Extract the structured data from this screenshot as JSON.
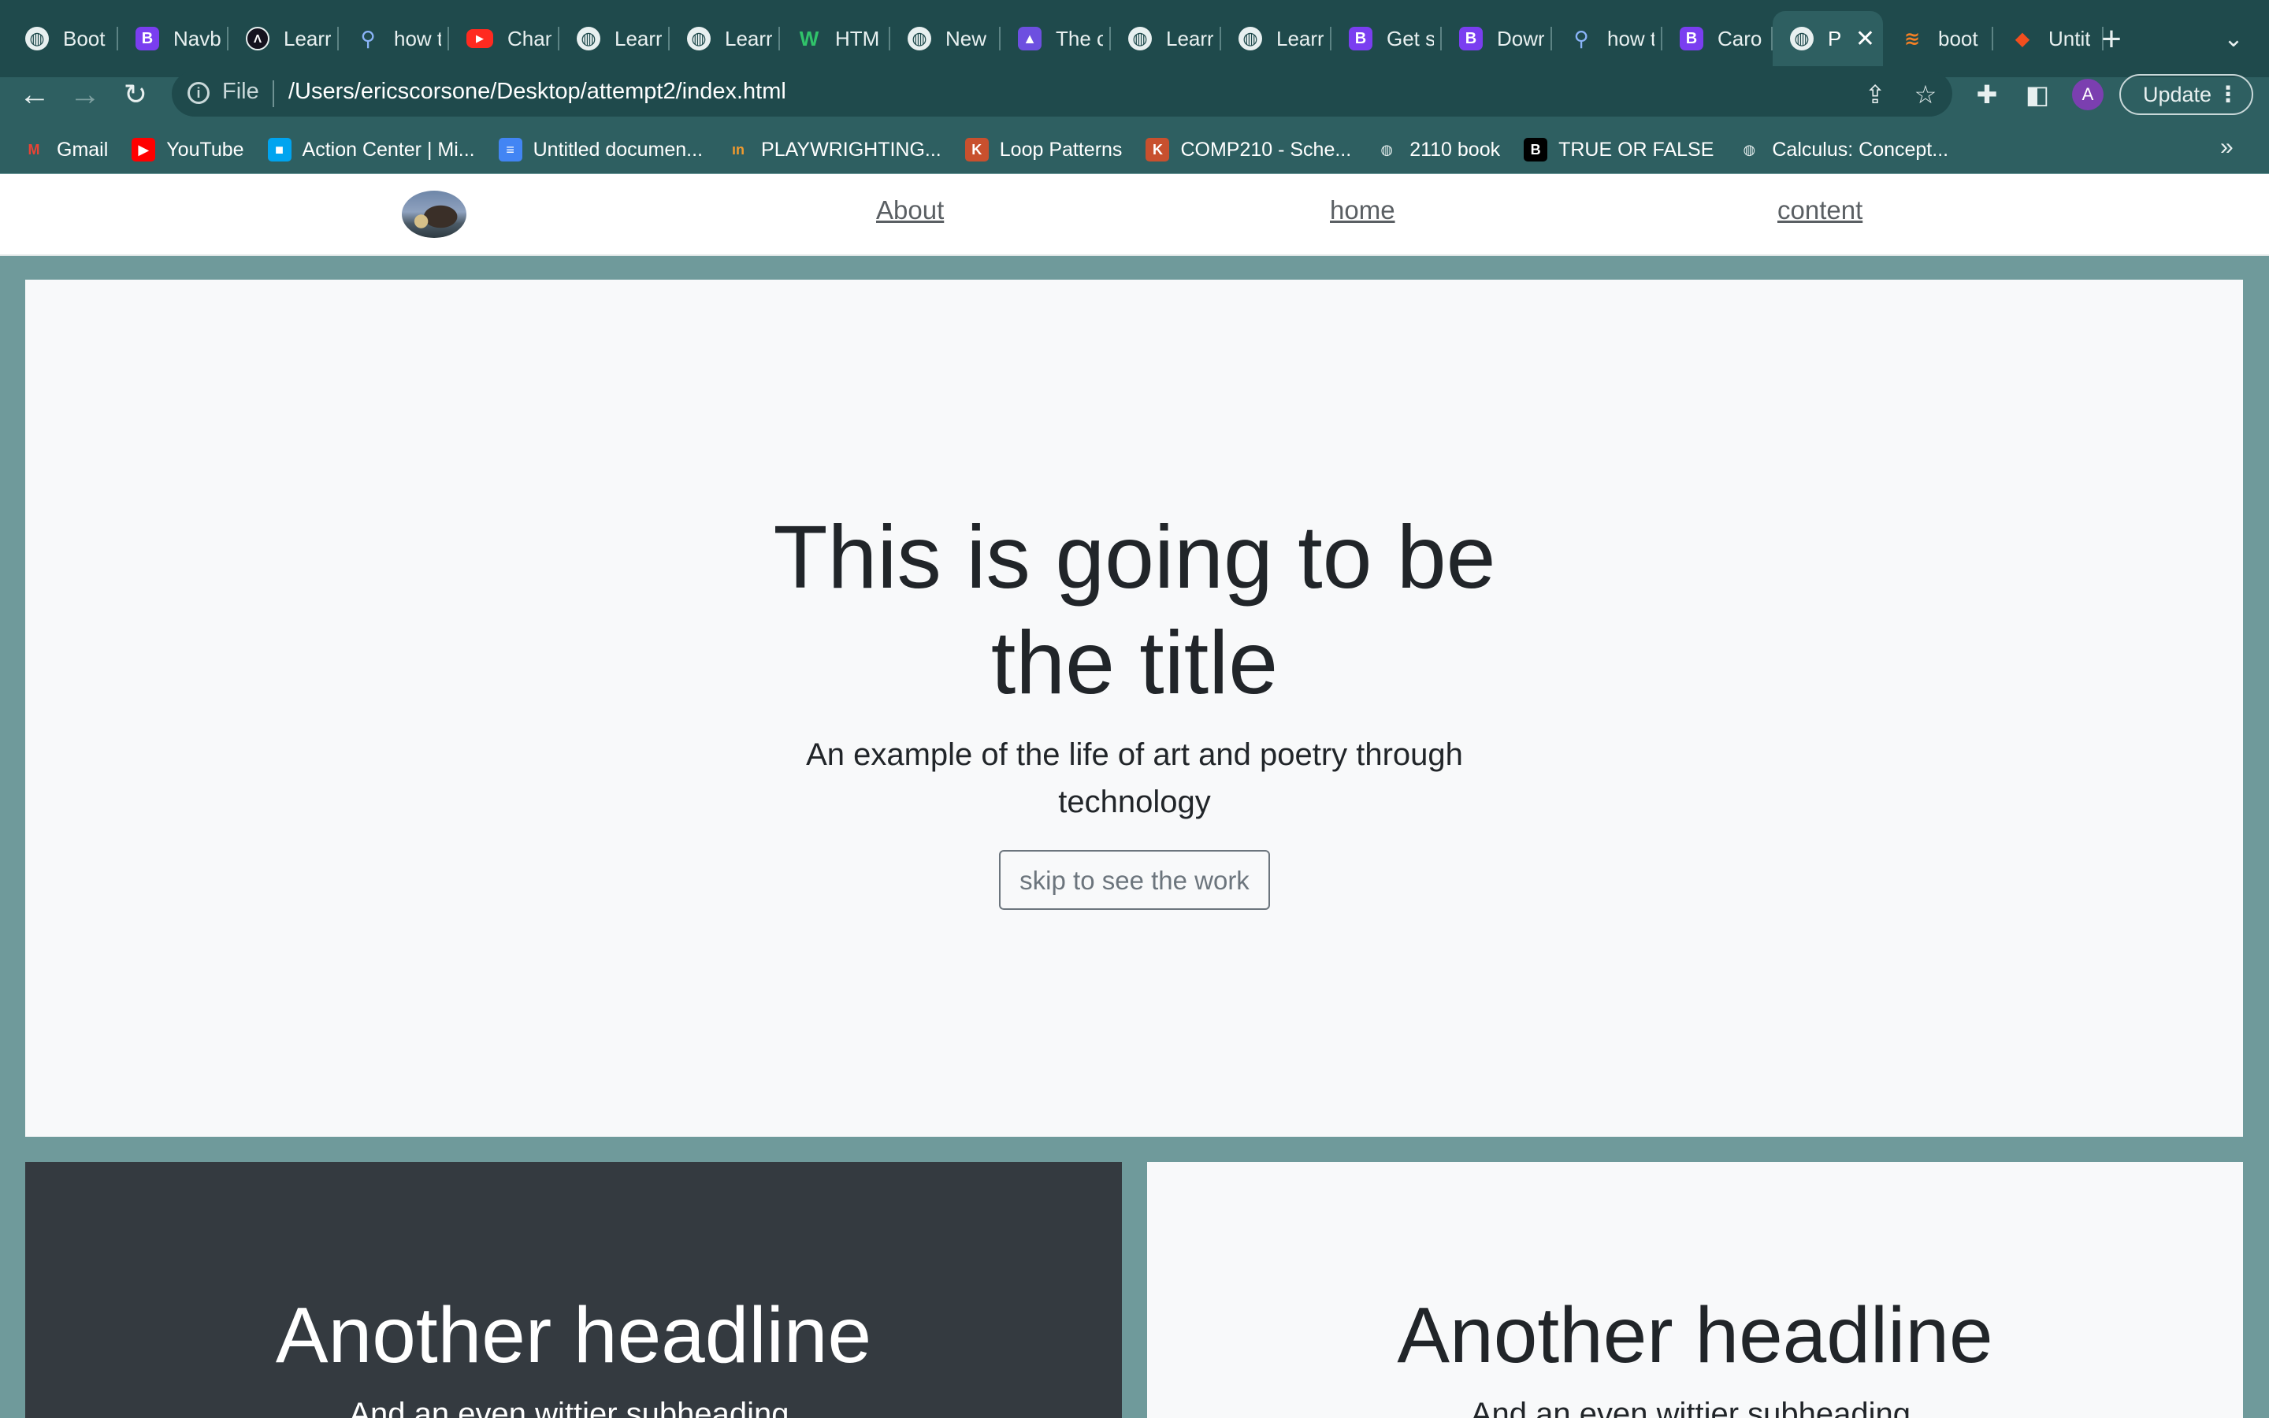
{
  "browser": {
    "tabs": [
      {
        "icon": "globe-icon",
        "label": "Boot"
      },
      {
        "icon": "bootstrap-icon",
        "label": "Navb"
      },
      {
        "icon": "learn-icon",
        "label": "Learr"
      },
      {
        "icon": "search-icon",
        "label": "how t"
      },
      {
        "icon": "youtube-icon",
        "label": "Chan"
      },
      {
        "icon": "globe-icon",
        "label": "Learr"
      },
      {
        "icon": "globe-icon",
        "label": "Learr"
      },
      {
        "icon": "w-icon",
        "label": "HTM"
      },
      {
        "icon": "globe-icon",
        "label": "New"
      },
      {
        "icon": "rocket-icon",
        "label": "The c"
      },
      {
        "icon": "globe-icon",
        "label": "Learr"
      },
      {
        "icon": "globe-icon",
        "label": "Learr"
      },
      {
        "icon": "bootstrap-icon",
        "label": "Get s"
      },
      {
        "icon": "bootstrap-icon",
        "label": "Dowr"
      },
      {
        "icon": "search-icon",
        "label": "how t"
      },
      {
        "icon": "bootstrap-icon",
        "label": "Caro"
      },
      {
        "icon": "globe-icon",
        "label": "Pr",
        "active": true
      },
      {
        "icon": "stackoverflow-icon",
        "label": "boot"
      },
      {
        "icon": "figma-icon",
        "label": "Untit"
      }
    ],
    "address": {
      "scheme_label": "File",
      "url": "/Users/ericscorsone/Desktop/attempt2/index.html"
    },
    "profile_initial": "A",
    "update_label": "Update",
    "bookmarks": [
      {
        "icon": "gmail-icon",
        "label": "Gmail",
        "color": "#ea4335"
      },
      {
        "icon": "youtube-icon",
        "label": "YouTube",
        "color": "#ff0000"
      },
      {
        "icon": "microsoft-icon",
        "label": "Action Center | Mi...",
        "color": "#00a4ef"
      },
      {
        "icon": "docs-icon",
        "label": "Untitled documen...",
        "color": "#4285f4"
      },
      {
        "icon": "playwrighting-icon",
        "label": "PLAYWRIGHTING...",
        "color": "#f29a2e"
      },
      {
        "icon": "loop-icon",
        "label": "Loop Patterns",
        "color": "#c8502e"
      },
      {
        "icon": "comp-icon",
        "label": "COMP210 - Sche...",
        "color": "#c8502e"
      },
      {
        "icon": "globe-icon",
        "label": "2110 book",
        "color": "#e8f0f0"
      },
      {
        "icon": "b-black-icon",
        "label": "TRUE OR FALSE",
        "color": "#000000"
      },
      {
        "icon": "globe-icon",
        "label": "Calculus: Concept...",
        "color": "#e8f0f0"
      }
    ]
  },
  "site": {
    "nav": {
      "links": [
        "About",
        "home",
        "content"
      ]
    },
    "hero": {
      "title": "This is going to be the title",
      "subtitle": "An example of the life of art and poetry through technology",
      "button_label": "skip to see the work"
    },
    "cards": [
      {
        "title": "Another headline",
        "subtitle": "And an even wittier subheading."
      },
      {
        "title": "Another headline",
        "subtitle": "And an even wittier subheading."
      }
    ]
  }
}
